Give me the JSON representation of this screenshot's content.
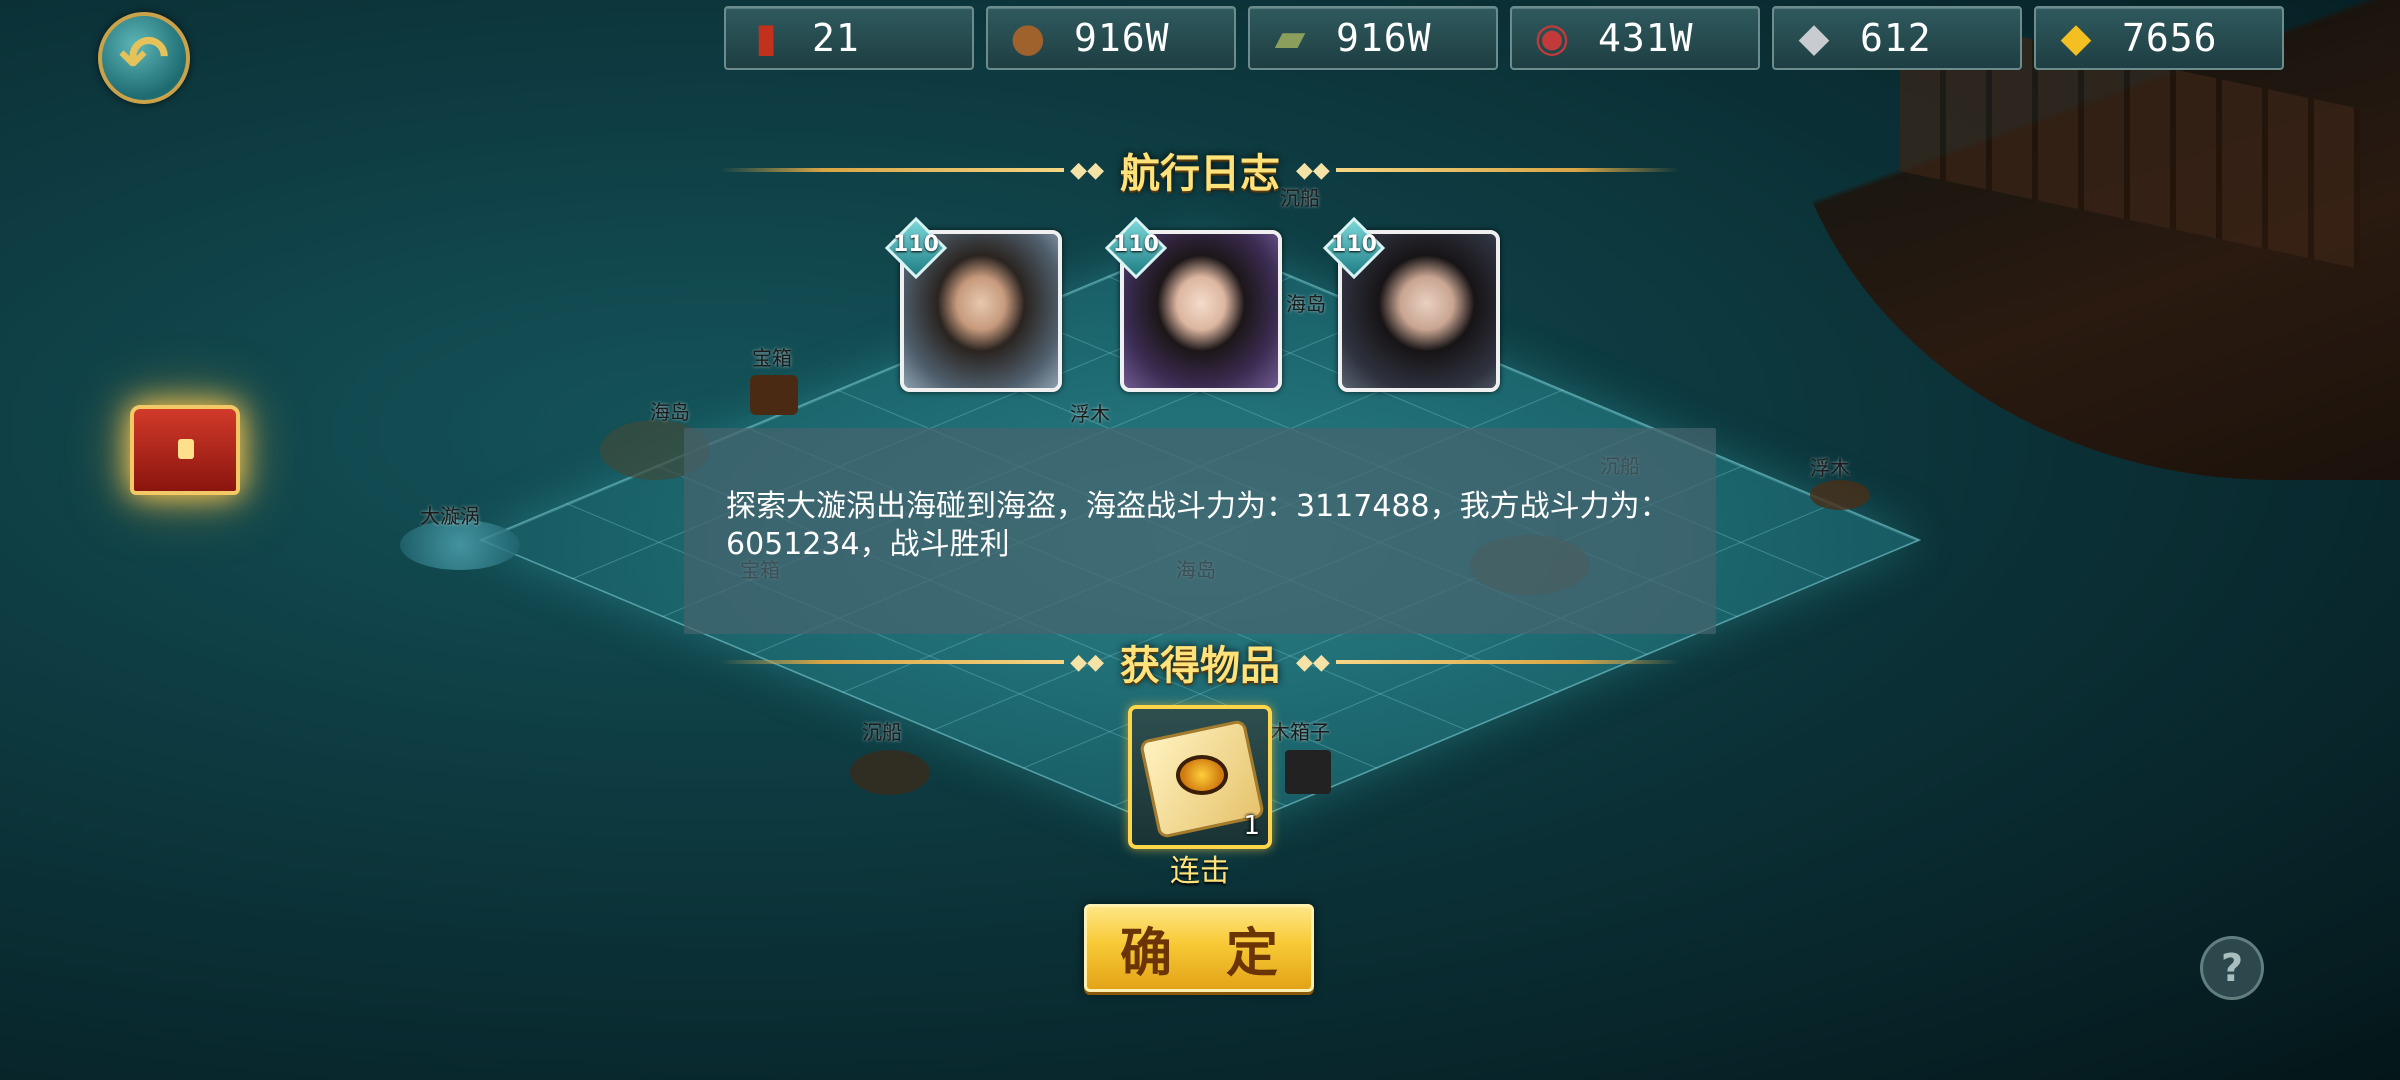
{
  "resources": [
    {
      "icon": "token-icon",
      "value": "21",
      "color": "#c2301e"
    },
    {
      "icon": "wood-icon",
      "value": "916W",
      "color": "#a0622c"
    },
    {
      "icon": "stone-icon",
      "value": "916W",
      "color": "#8c9e5c"
    },
    {
      "icon": "meat-icon",
      "value": "431W",
      "color": "#c23a3a"
    },
    {
      "icon": "silver-icon",
      "value": "612",
      "color": "#c8ccd0"
    },
    {
      "icon": "gold-icon",
      "value": "7656",
      "color": "#f4c021"
    }
  ],
  "map_labels": [
    "宝箱",
    "海岛",
    "浮木",
    "沉船",
    "海岛",
    "大漩涡",
    "沉船",
    "浮木",
    "宝箱",
    "海岛",
    "沉船",
    "木箱子"
  ],
  "voyage_log": {
    "title": "航行日志",
    "heroes": [
      {
        "level": "110"
      },
      {
        "level": "110"
      },
      {
        "level": "110"
      }
    ],
    "message": "探索大漩涡出海碰到海盗，海盗战斗力为：3117488，我方战斗力为：6051234，战斗胜利"
  },
  "rewards": {
    "title": "获得物品",
    "items": [
      {
        "name": "连击",
        "count": "1"
      }
    ]
  },
  "confirm_label": "确 定",
  "help_label": "?"
}
